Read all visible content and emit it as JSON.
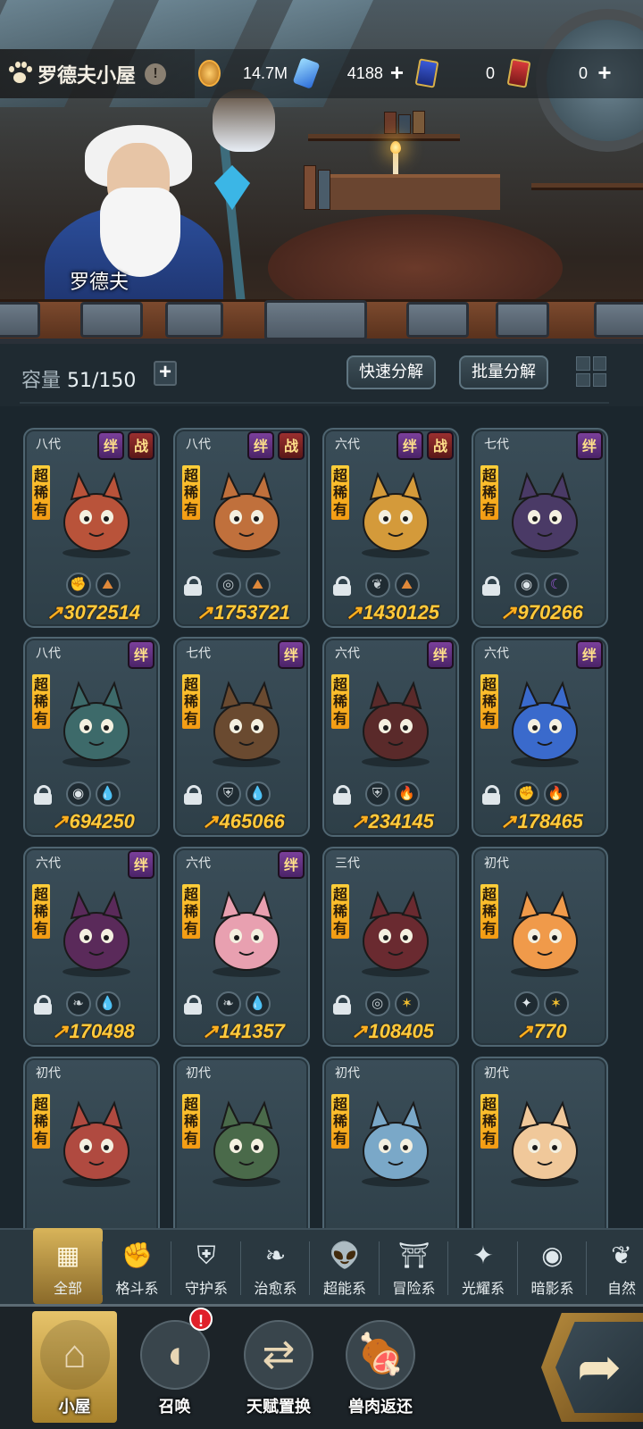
{
  "header": {
    "title": "罗德夫小屋",
    "npc_name": "罗德夫",
    "resources": [
      {
        "icon": "gold-coin-icon",
        "value": "14.7M",
        "addable": false
      },
      {
        "icon": "crystal-icon",
        "value": "4188",
        "addable": true
      },
      {
        "icon": "blue-ticket-icon",
        "value": "0",
        "addable": false
      },
      {
        "icon": "red-gold-ticket-icon",
        "value": "0",
        "addable": true
      }
    ]
  },
  "storage": {
    "label": "容量",
    "value": "51/150",
    "quick_decompose": "快速分解",
    "batch_decompose": "批量分解"
  },
  "badges": {
    "bond": "绊",
    "battle": "战"
  },
  "rarity_text": "超稀有",
  "pets": [
    {
      "gen": "八代",
      "bond": true,
      "battle": true,
      "locked": false,
      "elements": [
        "fist-icon",
        "mountain-icon"
      ],
      "power": "3072514",
      "color": "#b9533a"
    },
    {
      "gen": "八代",
      "bond": true,
      "battle": true,
      "locked": true,
      "elements": [
        "target-icon",
        "mountain-icon"
      ],
      "power": "1753721",
      "color": "#c0703c"
    },
    {
      "gen": "六代",
      "bond": true,
      "battle": true,
      "locked": true,
      "elements": [
        "leaf-wind-icon",
        "mountain-icon"
      ],
      "power": "1430125",
      "color": "#d49a3a"
    },
    {
      "gen": "七代",
      "bond": true,
      "battle": false,
      "locked": true,
      "elements": [
        "eye-icon",
        "moon-icon"
      ],
      "power": "970266",
      "color": "#4a3a66"
    },
    {
      "gen": "八代",
      "bond": true,
      "battle": false,
      "locked": true,
      "elements": [
        "eye-icon",
        "water-drop-icon"
      ],
      "power": "694250",
      "color": "#3d6a6a"
    },
    {
      "gen": "七代",
      "bond": true,
      "battle": false,
      "locked": true,
      "elements": [
        "shield-icon",
        "water-drop-icon"
      ],
      "power": "465066",
      "color": "#6a4a30"
    },
    {
      "gen": "六代",
      "bond": true,
      "battle": false,
      "locked": true,
      "elements": [
        "shield-icon",
        "fire-icon"
      ],
      "power": "234145",
      "color": "#5a2a2a"
    },
    {
      "gen": "六代",
      "bond": true,
      "battle": false,
      "locked": true,
      "elements": [
        "fist-icon",
        "fire-icon"
      ],
      "power": "178465",
      "color": "#3a6acc"
    },
    {
      "gen": "六代",
      "bond": true,
      "battle": false,
      "locked": true,
      "elements": [
        "sprout-icon",
        "water-drop-icon"
      ],
      "power": "170498",
      "color": "#5a2a5a"
    },
    {
      "gen": "六代",
      "bond": true,
      "battle": false,
      "locked": true,
      "elements": [
        "sprout-icon",
        "water-drop-icon"
      ],
      "power": "141357",
      "color": "#e8a0b0"
    },
    {
      "gen": "三代",
      "bond": false,
      "battle": false,
      "locked": true,
      "elements": [
        "target-icon",
        "star-icon"
      ],
      "power": "108405",
      "color": "#6a2a30"
    },
    {
      "gen": "初代",
      "bond": false,
      "battle": false,
      "locked": false,
      "elements": [
        "compass-star-icon",
        "star-icon"
      ],
      "power": "770",
      "color": "#f09a4a"
    },
    {
      "gen": "初代",
      "bond": false,
      "battle": false,
      "locked": false,
      "elements": [],
      "power": "",
      "color": "#b04a40"
    },
    {
      "gen": "初代",
      "bond": false,
      "battle": false,
      "locked": false,
      "elements": [],
      "power": "",
      "color": "#4a6a4a"
    },
    {
      "gen": "初代",
      "bond": false,
      "battle": false,
      "locked": false,
      "elements": [],
      "power": "",
      "color": "#7aa8c8"
    },
    {
      "gen": "初代",
      "bond": false,
      "battle": false,
      "locked": false,
      "elements": [],
      "power": "",
      "color": "#f0c89a"
    }
  ],
  "categories": [
    {
      "label": "全部",
      "icon": "all-blocks-icon",
      "active": true
    },
    {
      "label": "格斗系",
      "icon": "fist-icon",
      "active": false
    },
    {
      "label": "守护系",
      "icon": "shield-icon",
      "active": false
    },
    {
      "label": "治愈系",
      "icon": "sprout-icon",
      "active": false
    },
    {
      "label": "超能系",
      "icon": "alien-icon",
      "active": false
    },
    {
      "label": "冒险系",
      "icon": "lantern-icon",
      "active": false
    },
    {
      "label": "光耀系",
      "icon": "compass-star-icon",
      "active": false
    },
    {
      "label": "暗影系",
      "icon": "eye-icon",
      "active": false
    },
    {
      "label": "自然",
      "icon": "leaf-icon",
      "active": false
    }
  ],
  "nav": [
    {
      "label": "小屋",
      "icon": "house-icon",
      "active": true
    },
    {
      "label": "召唤",
      "icon": "egg-icon",
      "active": false,
      "alert": "!"
    },
    {
      "label": "天赋置换",
      "icon": "swap-arrows-icon",
      "active": false
    },
    {
      "label": "兽肉返还",
      "icon": "meat-icon",
      "active": false
    }
  ],
  "colors": {
    "power": "#ffca3c",
    "rarity": "#f7b22a",
    "bond_badge": "#6a3590",
    "battle_badge": "#8a2a2a",
    "alert": "#e0202a"
  }
}
